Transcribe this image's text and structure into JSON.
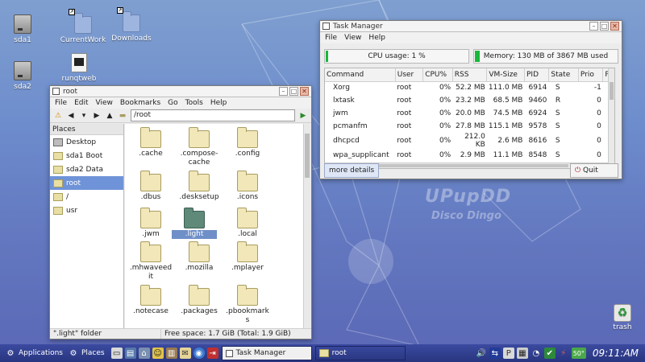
{
  "desktop": {
    "icons": [
      {
        "label": "sda1",
        "icon": "drive-icon"
      },
      {
        "label": "sda2",
        "icon": "drive-icon"
      },
      {
        "label": "CurrentWork",
        "icon": "folder-link-icon"
      },
      {
        "label": "Downloads",
        "icon": "folder-link-icon"
      },
      {
        "label": "runqtweb",
        "icon": "script-icon"
      },
      {
        "label": "trash",
        "icon": "recycle-icon"
      }
    ],
    "watermark_line1": "UPupDD",
    "watermark_line2": "Disco Dingo"
  },
  "task_manager": {
    "title": "Task Manager",
    "menu": [
      "File",
      "View",
      "Help"
    ],
    "cpu_text": "CPU usage: 1 %",
    "cpu_fraction": 0.01,
    "mem_text": "Memory: 130 MB of 3867 MB used",
    "mem_fraction": 0.034,
    "columns": [
      "Command",
      "User",
      "CPU%",
      "RSS",
      "VM-Size",
      "PID",
      "State",
      "Prio",
      "P"
    ],
    "rows": [
      [
        "Xorg",
        "root",
        "0%",
        "52.2 MB",
        "111.0 MB",
        "6914",
        "S",
        "-1"
      ],
      [
        "lxtask",
        "root",
        "0%",
        "23.2 MB",
        "68.5 MB",
        "9460",
        "R",
        "0"
      ],
      [
        "jwm",
        "root",
        "0%",
        "20.0 MB",
        "74.5 MB",
        "6924",
        "S",
        "0"
      ],
      [
        "pcmanfm",
        "root",
        "0%",
        "27.8 MB",
        "115.1 MB",
        "9578",
        "S",
        "0"
      ],
      [
        "dhcpcd",
        "root",
        "0%",
        "212.0 KB",
        "2.6 MB",
        "8616",
        "S",
        "0"
      ],
      [
        "wpa_supplicant",
        "root",
        "0%",
        "2.9 MB",
        "11.1 MB",
        "8548",
        "S",
        "0"
      ]
    ],
    "more_details": "more details",
    "quit": "Quit"
  },
  "file_manager": {
    "title": "root",
    "menu": [
      "File",
      "Edit",
      "View",
      "Bookmarks",
      "Go",
      "Tools",
      "Help"
    ],
    "path": "/root",
    "places_header": "Places",
    "places": [
      {
        "label": "Desktop",
        "icon": "desktop-icon"
      },
      {
        "label": "sda1 Boot",
        "icon": "folder-icon"
      },
      {
        "label": "sda2 Data",
        "icon": "folder-icon"
      },
      {
        "label": "root",
        "icon": "folder-icon",
        "selected": true
      },
      {
        "label": "/",
        "icon": "folder-icon"
      },
      {
        "label": "usr",
        "icon": "folder-icon"
      }
    ],
    "files": [
      {
        "label": ".cache"
      },
      {
        "label": ".compose-cache"
      },
      {
        "label": ".config"
      },
      {
        "label": ".dbus"
      },
      {
        "label": ".desksetup"
      },
      {
        "label": ".icons"
      },
      {
        "label": ".jwm"
      },
      {
        "label": ".light",
        "selected": true
      },
      {
        "label": ".local"
      },
      {
        "label": ".mhwaveedit"
      },
      {
        "label": ".mozilla"
      },
      {
        "label": ".mplayer"
      },
      {
        "label": ".notecase"
      },
      {
        "label": ".packages"
      },
      {
        "label": ".pbookmarks"
      }
    ],
    "status_left": "\".light\" folder",
    "status_right": "Free space: 1.7 GiB (Total: 1.9 GiB)"
  },
  "taskbar": {
    "applications": "Applications",
    "places": "Places",
    "tasks": [
      {
        "label": "Task Manager",
        "active": true
      },
      {
        "label": "root",
        "active": false
      }
    ],
    "temp": "50°",
    "clock": "09:11:AM"
  },
  "colors": {
    "desktop_top": "#7f9fd0",
    "desktop_bottom": "#5a67b5",
    "selection": "#6f93d8",
    "meter_green": "#18b83b",
    "taskbar": "#2f3c8c"
  }
}
